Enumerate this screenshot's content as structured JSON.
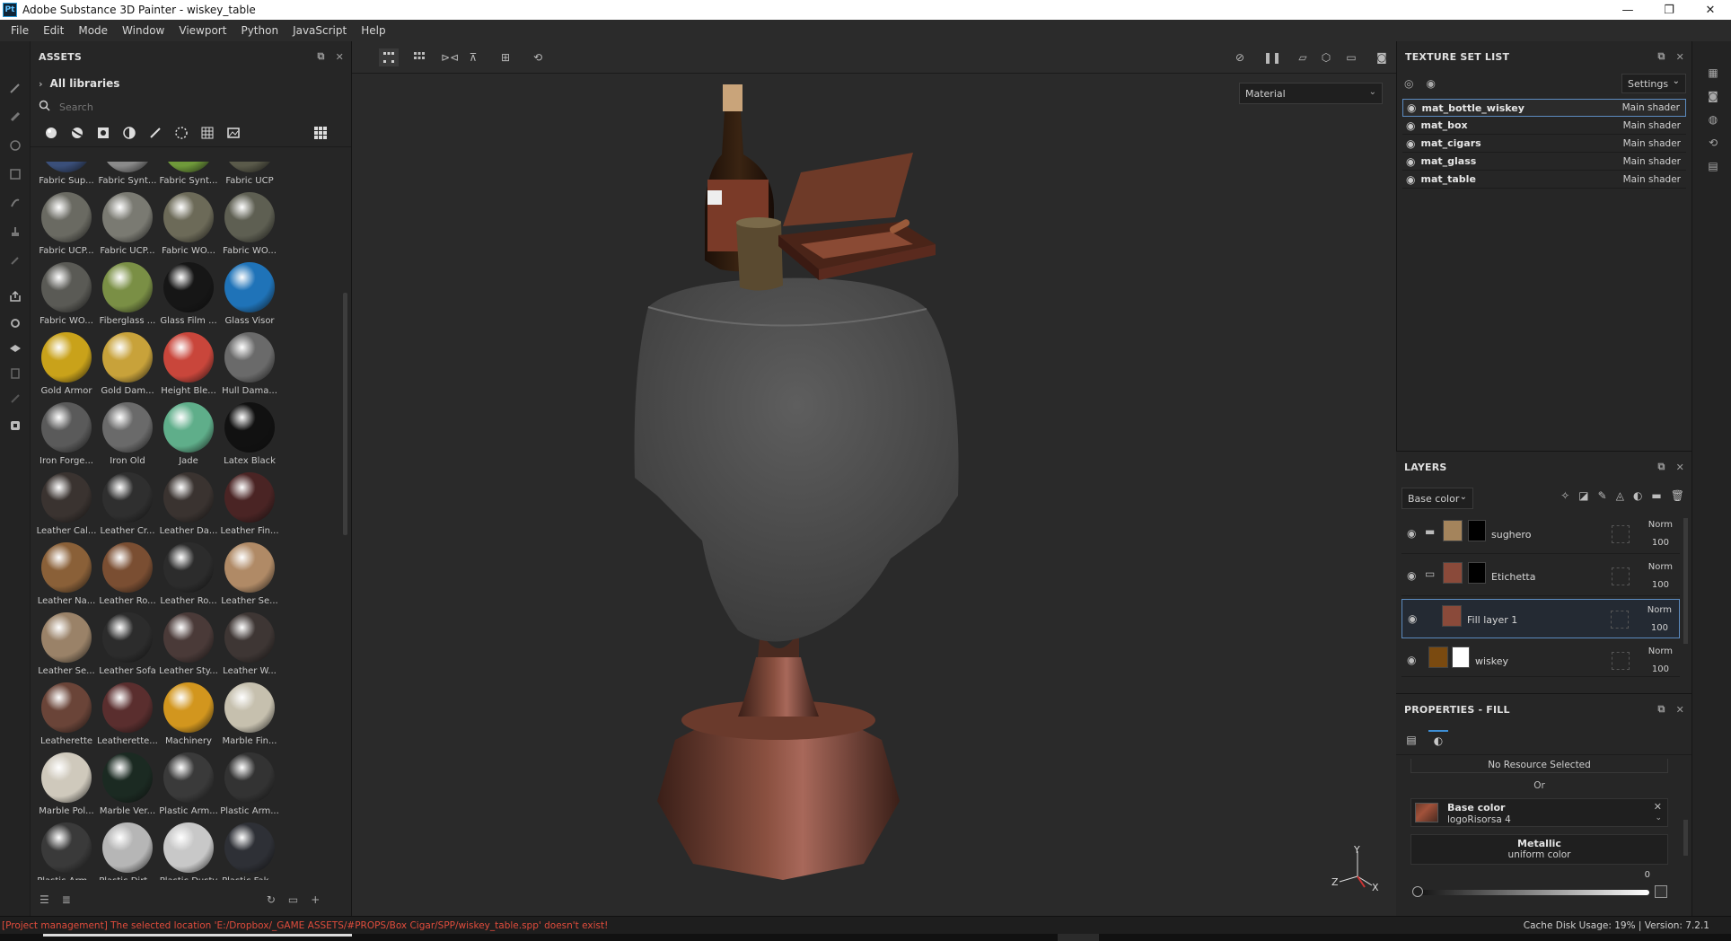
{
  "window": {
    "app_icon_label": "Pt",
    "title": "Adobe Substance 3D Painter - wiskey_table",
    "minimize": "—",
    "maximize": "❐",
    "close": "✕"
  },
  "menu": [
    "File",
    "Edit",
    "Mode",
    "Window",
    "Viewport",
    "Python",
    "JavaScript",
    "Help"
  ],
  "assets": {
    "title": "ASSETS",
    "library": "All libraries",
    "search_placeholder": "Search",
    "items": [
      {
        "label": "Fabric Sup...",
        "color": "#3a4f7a"
      },
      {
        "label": "Fabric Synt...",
        "color": "#8a8a8a"
      },
      {
        "label": "Fabric Synt...",
        "color": "#6f9a3a"
      },
      {
        "label": "Fabric UCP",
        "color": "#5a5a4a"
      },
      {
        "label": "Fabric UCP...",
        "color": "#6a6a62"
      },
      {
        "label": "Fabric UCP...",
        "color": "#7a7a72"
      },
      {
        "label": "Fabric WO...",
        "color": "#6c6a58"
      },
      {
        "label": "Fabric WO...",
        "color": "#5e5f52"
      },
      {
        "label": "Fabric WO...",
        "color": "#5a5a55"
      },
      {
        "label": "Fiberglass ...",
        "color": "#7a8f45"
      },
      {
        "label": "Glass Film ...",
        "color": "#161616"
      },
      {
        "label": "Glass Visor",
        "color": "#1f73b8"
      },
      {
        "label": "Gold Armor",
        "color": "#c9a21a"
      },
      {
        "label": "Gold Dam...",
        "color": "#c8a23a"
      },
      {
        "label": "Height Ble...",
        "color": "#c9463b"
      },
      {
        "label": "Hull Dama...",
        "color": "#6a6a6a"
      },
      {
        "label": "Iron Forge...",
        "color": "#5a5a5a"
      },
      {
        "label": "Iron Old",
        "color": "#6a6a6a"
      },
      {
        "label": "Jade",
        "color": "#5fae8a"
      },
      {
        "label": "Latex Black",
        "color": "#111111"
      },
      {
        "label": "Leather Cal...",
        "color": "#3a3330"
      },
      {
        "label": "Leather Cr...",
        "color": "#2f2f2f"
      },
      {
        "label": "Leather Da...",
        "color": "#3a3330"
      },
      {
        "label": "Leather Fin...",
        "color": "#4a2424"
      },
      {
        "label": "Leather Na...",
        "color": "#8a6038"
      },
      {
        "label": "Leather Ro...",
        "color": "#7a4e32"
      },
      {
        "label": "Leather Ro...",
        "color": "#2c2c2c"
      },
      {
        "label": "Leather Se...",
        "color": "#b08a66"
      },
      {
        "label": "Leather Se...",
        "color": "#9a8268"
      },
      {
        "label": "Leather Sofa",
        "color": "#2c2c2c"
      },
      {
        "label": "Leather Sty...",
        "color": "#4a3a38"
      },
      {
        "label": "Leather W...",
        "color": "#3e3634"
      },
      {
        "label": "Leatherette",
        "color": "#6a4438"
      },
      {
        "label": "Leatherette...",
        "color": "#5a2e2e"
      },
      {
        "label": "Machinery",
        "color": "#d2961e"
      },
      {
        "label": "Marble Fin...",
        "color": "#c6c0ae"
      },
      {
        "label": "Marble Pol...",
        "color": "#cfc9bc"
      },
      {
        "label": "Marble Ver...",
        "color": "#1b2a22"
      },
      {
        "label": "Plastic Arm...",
        "color": "#3a3a3a"
      },
      {
        "label": "Plastic Arm...",
        "color": "#333333"
      },
      {
        "label": "Plastic Arm...",
        "color": "#3a3a3a"
      },
      {
        "label": "Plastic Dirt...",
        "color": "#b6b6b6"
      },
      {
        "label": "Plastic Dusty",
        "color": "#c8c8c8"
      },
      {
        "label": "Plastic Fak...",
        "color": "#2e3036"
      }
    ]
  },
  "viewport": {
    "material_mode": "Material"
  },
  "texture_set_list": {
    "title": "TEXTURE SET LIST",
    "settings_label": "Settings",
    "rows": [
      {
        "name": "mat_bottle_wiskey",
        "shader": "Main shader"
      },
      {
        "name": "mat_box",
        "shader": "Main shader"
      },
      {
        "name": "mat_cigars",
        "shader": "Main shader"
      },
      {
        "name": "mat_glass",
        "shader": "Main shader"
      },
      {
        "name": "mat_table",
        "shader": "Main shader"
      }
    ]
  },
  "layers": {
    "title": "LAYERS",
    "channel": "Base color",
    "rows": [
      {
        "name": "sughero",
        "blend": "Norm",
        "opacity": "100",
        "thumb": "#a4845c"
      },
      {
        "name": "Etichetta",
        "blend": "Norm",
        "opacity": "100",
        "thumb": "#8a4a3a"
      },
      {
        "name": "Fill layer 1",
        "blend": "Norm",
        "opacity": "100",
        "thumb": "#8a4a3a"
      },
      {
        "name": "wiskey",
        "blend": "Norm",
        "opacity": "100",
        "thumb": "#7a4a10"
      }
    ]
  },
  "properties": {
    "title": "PROPERTIES - FILL",
    "no_resource": "No Resource Selected",
    "or_label": "Or",
    "base_color_title": "Base color",
    "base_color_resource": "logoRisorsa 4",
    "metallic_title": "Metallic",
    "metallic_sub": "uniform color",
    "metallic_value": "0"
  },
  "axis_gizmo": {
    "y": "Y",
    "z": "Z",
    "x": "X"
  },
  "status": {
    "message": "[Project management] The selected location 'E:/Dropbox/_GAME ASSETS/#PROPS/Box Cigar/SPP/wiskey_table.spp' doesn't exist!",
    "right": "Cache Disk Usage:   19%  |  Version: 7.2.1"
  }
}
